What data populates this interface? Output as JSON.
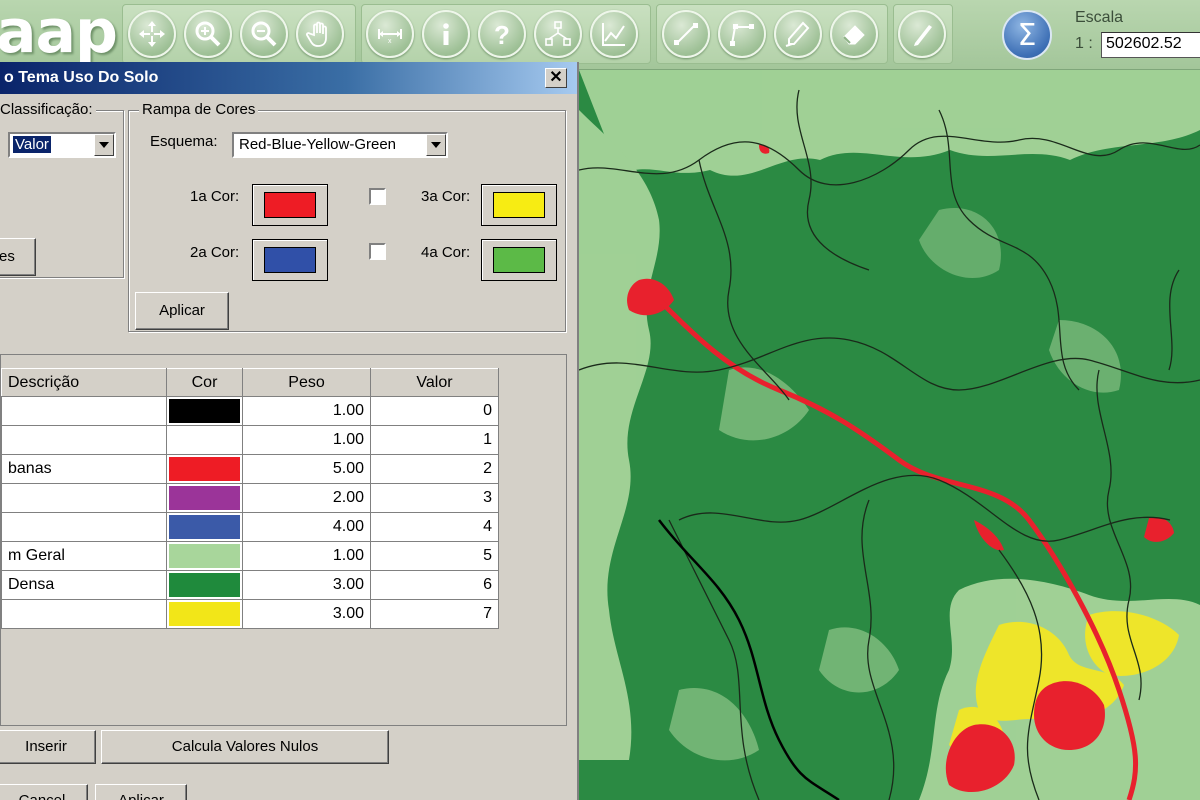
{
  "app": {
    "logo": "aap"
  },
  "toolbar": {
    "tools": [
      {
        "icon": "pan-icon"
      },
      {
        "icon": "zoom-in-icon"
      },
      {
        "icon": "zoom-out-icon"
      },
      {
        "icon": "hand-icon"
      },
      {
        "icon": "measure-icon"
      },
      {
        "icon": "info-icon"
      },
      {
        "icon": "help-icon"
      },
      {
        "icon": "network-icon"
      },
      {
        "icon": "graph-icon"
      },
      {
        "icon": "draw-line-icon"
      },
      {
        "icon": "draw-polyline-icon"
      },
      {
        "icon": "edit-pencil-icon"
      },
      {
        "icon": "eraser-icon"
      },
      {
        "icon": "pencil-icon"
      }
    ],
    "sigma_label": "Σ",
    "scale_label": "Escala",
    "scale_prefix": "1 :",
    "scale_value": "502602.52"
  },
  "dialog": {
    "title": "o Tema Uso Do Solo",
    "close_label": "✕",
    "classificacao": {
      "title": "Classificação:",
      "combo_value": "Valor",
      "button_label": "es"
    },
    "rampa": {
      "title": "Rampa de Cores",
      "esquema_label": "Esquema:",
      "esquema_value": "Red-Blue-Yellow-Green",
      "cor1_label": "1a Cor:",
      "cor2_label": "2a Cor:",
      "cor3_label": "3a Cor:",
      "cor4_label": "4a Cor:",
      "cor1": "#ee1c25",
      "cor2": "#3050a8",
      "cor3": "#f7ec13",
      "cor4": "#5cba47",
      "aplicar_label": "Aplicar"
    },
    "table": {
      "headers": [
        "Descrição",
        "Cor",
        "Peso",
        "Valor"
      ],
      "rows": [
        {
          "descricao": "",
          "cor": "#000000",
          "peso": "1.00",
          "valor": "0"
        },
        {
          "descricao": "",
          "cor": "#ffffff",
          "peso": "1.00",
          "valor": "1"
        },
        {
          "descricao": "banas",
          "cor": "#ee1c25",
          "peso": "5.00",
          "valor": "2"
        },
        {
          "descricao": "",
          "cor": "#9b3499",
          "peso": "2.00",
          "valor": "3"
        },
        {
          "descricao": "",
          "cor": "#3b5aa8",
          "peso": "4.00",
          "valor": "4"
        },
        {
          "descricao": "m Geral",
          "cor": "#a8d69b",
          "peso": "1.00",
          "valor": "5"
        },
        {
          "descricao": "Densa",
          "cor": "#1f8a3c",
          "peso": "3.00",
          "valor": "6"
        },
        {
          "descricao": "",
          "cor": "#f2e618",
          "peso": "3.00",
          "valor": "7"
        }
      ]
    },
    "buttons": {
      "inserir": "Inserir",
      "calcula": "Calcula Valores Nulos",
      "cancel": "Cancel",
      "aplicar": "Aplicar"
    }
  }
}
